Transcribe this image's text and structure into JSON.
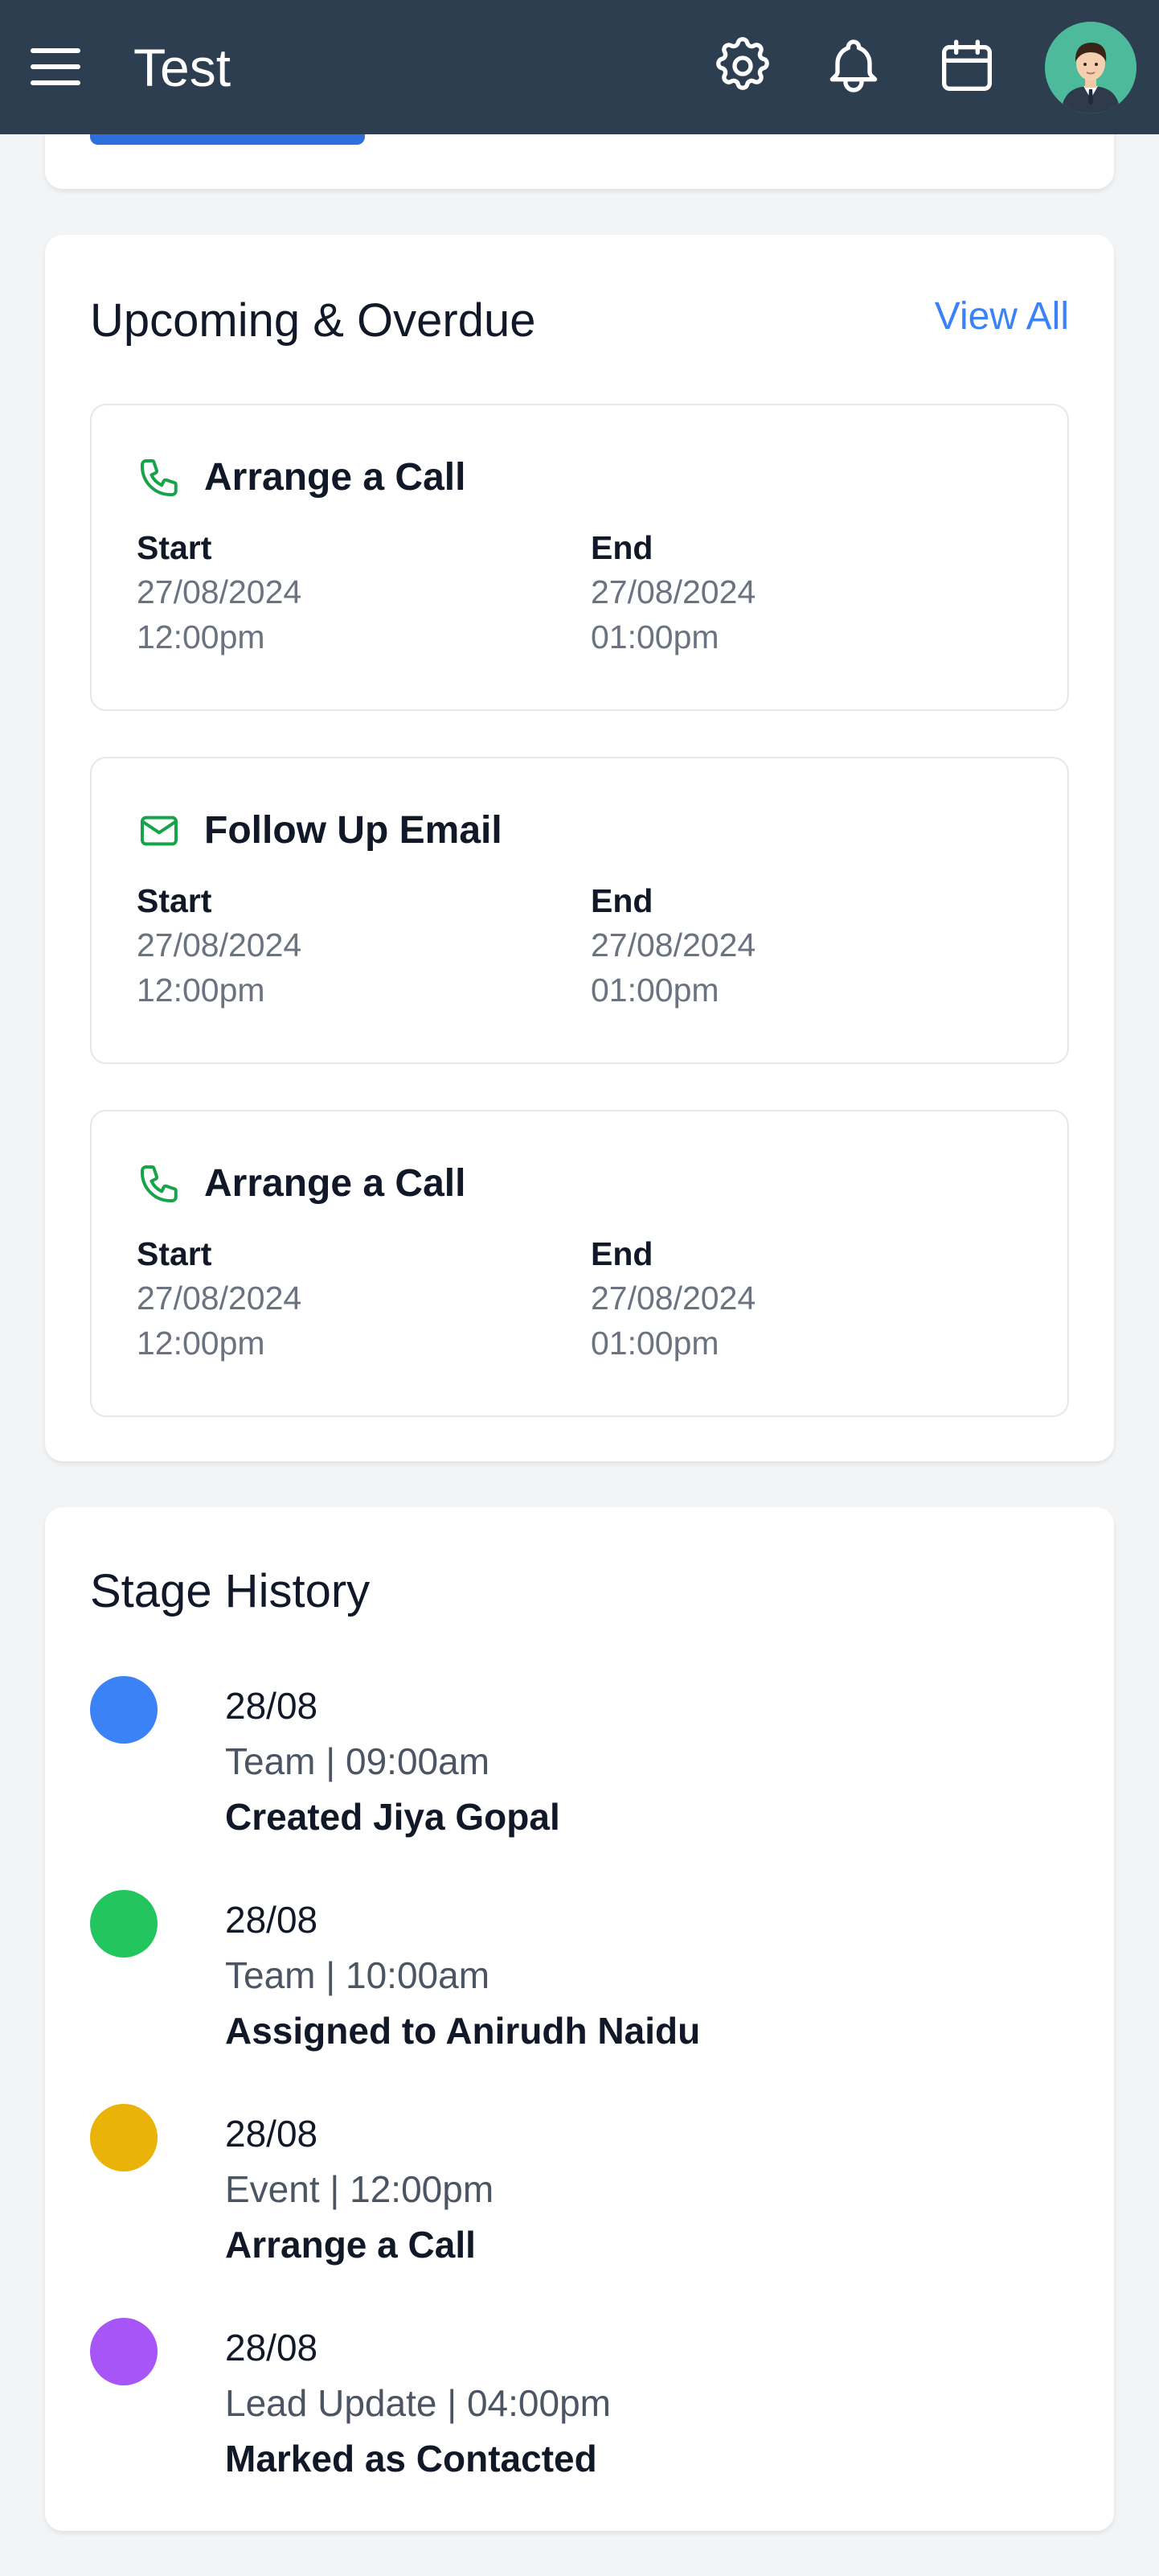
{
  "app": {
    "title": "Test"
  },
  "header_icons": {
    "menu": "hamburger-menu-icon",
    "settings": "gear-icon",
    "notifications": "bell-icon",
    "calendar": "calendar-icon",
    "avatar": "user-avatar"
  },
  "colors": {
    "header_bg": "#2d3e50",
    "accent_blue": "#3b82f6",
    "icon_green": "#16a34a"
  },
  "upcoming": {
    "title": "Upcoming & Overdue",
    "view_all": "View All",
    "tasks": [
      {
        "icon": "phone-icon",
        "title": "Arrange a Call",
        "start_label": "Start",
        "start_date": "27/08/2024",
        "start_time": "12:00pm",
        "end_label": "End",
        "end_date": "27/08/2024",
        "end_time": "01:00pm"
      },
      {
        "icon": "mail-icon",
        "title": "Follow Up Email",
        "start_label": "Start",
        "start_date": "27/08/2024",
        "start_time": "12:00pm",
        "end_label": "End",
        "end_date": "27/08/2024",
        "end_time": "01:00pm"
      },
      {
        "icon": "phone-icon",
        "title": "Arrange a Call",
        "start_label": "Start",
        "start_date": "27/08/2024",
        "start_time": "12:00pm",
        "end_label": "End",
        "end_date": "27/08/2024",
        "end_time": "01:00pm"
      }
    ]
  },
  "stage_history": {
    "title": "Stage History",
    "items": [
      {
        "date": "28/08",
        "meta": "Team | 09:00am",
        "description": "Created Jiya Gopal",
        "color": "#3b82f6"
      },
      {
        "date": "28/08",
        "meta": "Team | 10:00am",
        "description": "Assigned to Anirudh Naidu",
        "color": "#22c55e"
      },
      {
        "date": "28/08",
        "meta": "Event | 12:00pm",
        "description": "Arrange a Call",
        "color": "#eab308"
      },
      {
        "date": "28/08",
        "meta": "Lead Update | 04:00pm",
        "description": "Marked as Contacted",
        "color": "#a855f7"
      }
    ]
  }
}
